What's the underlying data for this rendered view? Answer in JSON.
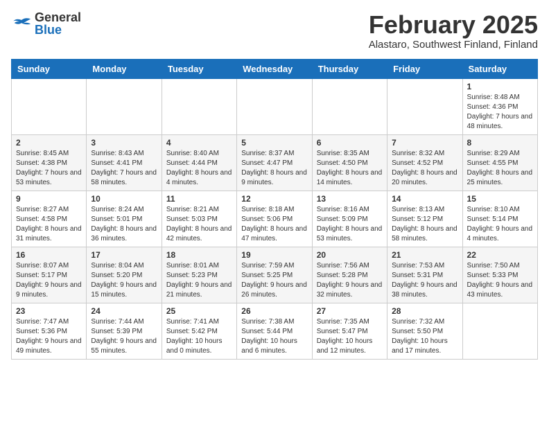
{
  "header": {
    "logo_general": "General",
    "logo_blue": "Blue",
    "title": "February 2025",
    "location": "Alastaro, Southwest Finland, Finland"
  },
  "days_of_week": [
    "Sunday",
    "Monday",
    "Tuesday",
    "Wednesday",
    "Thursday",
    "Friday",
    "Saturday"
  ],
  "weeks": [
    [
      {
        "day": "",
        "info": ""
      },
      {
        "day": "",
        "info": ""
      },
      {
        "day": "",
        "info": ""
      },
      {
        "day": "",
        "info": ""
      },
      {
        "day": "",
        "info": ""
      },
      {
        "day": "",
        "info": ""
      },
      {
        "day": "1",
        "info": "Sunrise: 8:48 AM\nSunset: 4:36 PM\nDaylight: 7 hours and 48 minutes."
      }
    ],
    [
      {
        "day": "2",
        "info": "Sunrise: 8:45 AM\nSunset: 4:38 PM\nDaylight: 7 hours and 53 minutes."
      },
      {
        "day": "3",
        "info": "Sunrise: 8:43 AM\nSunset: 4:41 PM\nDaylight: 7 hours and 58 minutes."
      },
      {
        "day": "4",
        "info": "Sunrise: 8:40 AM\nSunset: 4:44 PM\nDaylight: 8 hours and 4 minutes."
      },
      {
        "day": "5",
        "info": "Sunrise: 8:37 AM\nSunset: 4:47 PM\nDaylight: 8 hours and 9 minutes."
      },
      {
        "day": "6",
        "info": "Sunrise: 8:35 AM\nSunset: 4:50 PM\nDaylight: 8 hours and 14 minutes."
      },
      {
        "day": "7",
        "info": "Sunrise: 8:32 AM\nSunset: 4:52 PM\nDaylight: 8 hours and 20 minutes."
      },
      {
        "day": "8",
        "info": "Sunrise: 8:29 AM\nSunset: 4:55 PM\nDaylight: 8 hours and 25 minutes."
      }
    ],
    [
      {
        "day": "9",
        "info": "Sunrise: 8:27 AM\nSunset: 4:58 PM\nDaylight: 8 hours and 31 minutes."
      },
      {
        "day": "10",
        "info": "Sunrise: 8:24 AM\nSunset: 5:01 PM\nDaylight: 8 hours and 36 minutes."
      },
      {
        "day": "11",
        "info": "Sunrise: 8:21 AM\nSunset: 5:03 PM\nDaylight: 8 hours and 42 minutes."
      },
      {
        "day": "12",
        "info": "Sunrise: 8:18 AM\nSunset: 5:06 PM\nDaylight: 8 hours and 47 minutes."
      },
      {
        "day": "13",
        "info": "Sunrise: 8:16 AM\nSunset: 5:09 PM\nDaylight: 8 hours and 53 minutes."
      },
      {
        "day": "14",
        "info": "Sunrise: 8:13 AM\nSunset: 5:12 PM\nDaylight: 8 hours and 58 minutes."
      },
      {
        "day": "15",
        "info": "Sunrise: 8:10 AM\nSunset: 5:14 PM\nDaylight: 9 hours and 4 minutes."
      }
    ],
    [
      {
        "day": "16",
        "info": "Sunrise: 8:07 AM\nSunset: 5:17 PM\nDaylight: 9 hours and 9 minutes."
      },
      {
        "day": "17",
        "info": "Sunrise: 8:04 AM\nSunset: 5:20 PM\nDaylight: 9 hours and 15 minutes."
      },
      {
        "day": "18",
        "info": "Sunrise: 8:01 AM\nSunset: 5:23 PM\nDaylight: 9 hours and 21 minutes."
      },
      {
        "day": "19",
        "info": "Sunrise: 7:59 AM\nSunset: 5:25 PM\nDaylight: 9 hours and 26 minutes."
      },
      {
        "day": "20",
        "info": "Sunrise: 7:56 AM\nSunset: 5:28 PM\nDaylight: 9 hours and 32 minutes."
      },
      {
        "day": "21",
        "info": "Sunrise: 7:53 AM\nSunset: 5:31 PM\nDaylight: 9 hours and 38 minutes."
      },
      {
        "day": "22",
        "info": "Sunrise: 7:50 AM\nSunset: 5:33 PM\nDaylight: 9 hours and 43 minutes."
      }
    ],
    [
      {
        "day": "23",
        "info": "Sunrise: 7:47 AM\nSunset: 5:36 PM\nDaylight: 9 hours and 49 minutes."
      },
      {
        "day": "24",
        "info": "Sunrise: 7:44 AM\nSunset: 5:39 PM\nDaylight: 9 hours and 55 minutes."
      },
      {
        "day": "25",
        "info": "Sunrise: 7:41 AM\nSunset: 5:42 PM\nDaylight: 10 hours and 0 minutes."
      },
      {
        "day": "26",
        "info": "Sunrise: 7:38 AM\nSunset: 5:44 PM\nDaylight: 10 hours and 6 minutes."
      },
      {
        "day": "27",
        "info": "Sunrise: 7:35 AM\nSunset: 5:47 PM\nDaylight: 10 hours and 12 minutes."
      },
      {
        "day": "28",
        "info": "Sunrise: 7:32 AM\nSunset: 5:50 PM\nDaylight: 10 hours and 17 minutes."
      },
      {
        "day": "",
        "info": ""
      }
    ]
  ]
}
